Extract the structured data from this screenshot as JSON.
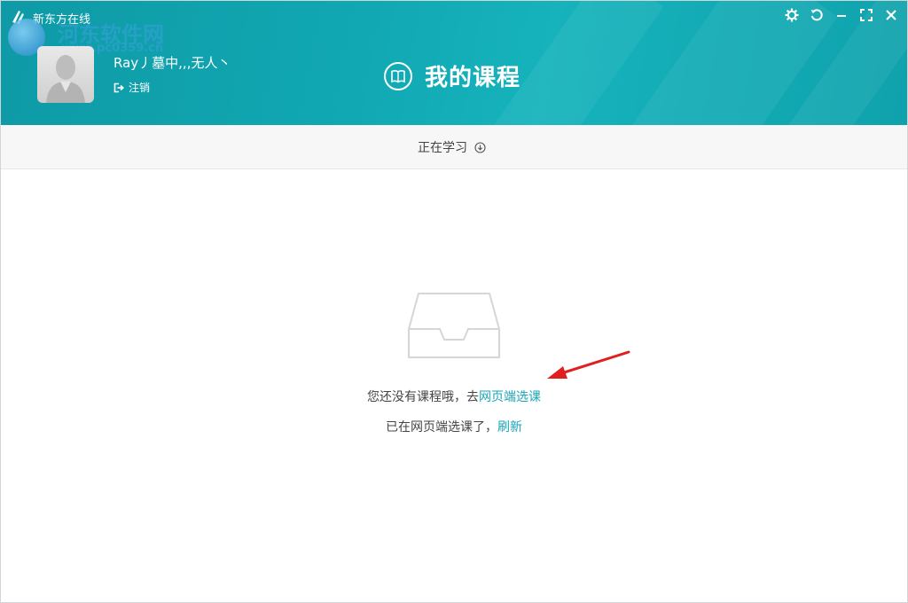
{
  "app": {
    "title": "新东方在线",
    "watermark_text": "河东软件网",
    "watermark_url": "www.pc0359.cn"
  },
  "user": {
    "name": "Ray丿墓中,,,无人丶",
    "logout_label": "注销"
  },
  "page": {
    "title": "我的课程",
    "title_icon": "book-icon"
  },
  "filter": {
    "selected": "正在学习",
    "icon": "chevron-down-circle-icon"
  },
  "empty_state": {
    "icon": "empty-tray-icon",
    "line1_text": "您还没有课程哦，去",
    "line1_link": "网页端选课",
    "line2_text": "已在网页端选课了，",
    "line2_link": "刷新"
  },
  "window_controls": [
    "gear-icon",
    "refresh-icon",
    "minimize-icon",
    "maximize-icon",
    "close-icon"
  ],
  "colors": {
    "header": "#11a8b3",
    "link": "#1aa5b8",
    "annotation_arrow": "#e02020"
  }
}
